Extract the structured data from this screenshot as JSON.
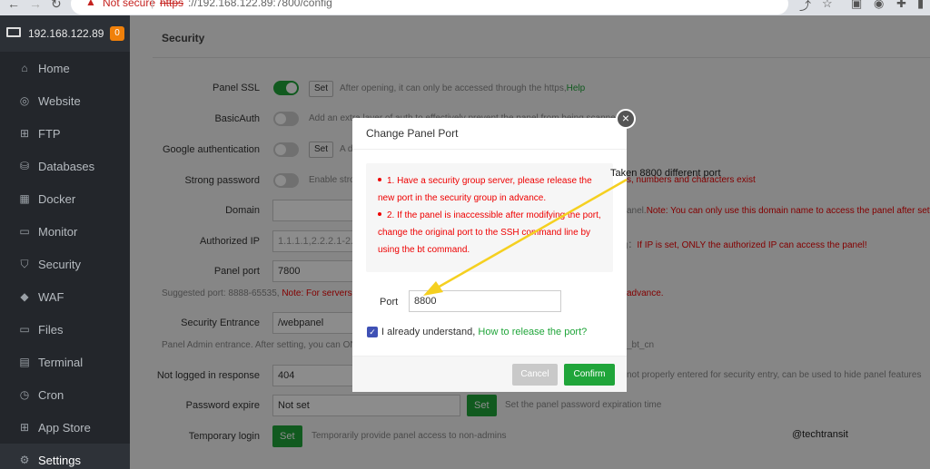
{
  "browser": {
    "not_secure": "Not secure",
    "url_scheme": "https",
    "url_rest": "://192.168.122.89:7800/config"
  },
  "sidebar": {
    "ip": "192.168.122.89",
    "badge": "0",
    "items": [
      {
        "label": "Home",
        "icon": "home-icon"
      },
      {
        "label": "Website",
        "icon": "globe-icon"
      },
      {
        "label": "FTP",
        "icon": "ftp-icon"
      },
      {
        "label": "Databases",
        "icon": "database-icon"
      },
      {
        "label": "Docker",
        "icon": "docker-icon"
      },
      {
        "label": "Monitor",
        "icon": "monitor-icon"
      },
      {
        "label": "Security",
        "icon": "shield-icon"
      },
      {
        "label": "WAF",
        "icon": "waf-icon"
      },
      {
        "label": "Files",
        "icon": "folder-icon"
      },
      {
        "label": "Terminal",
        "icon": "terminal-icon"
      },
      {
        "label": "Cron",
        "icon": "clock-icon"
      },
      {
        "label": "App Store",
        "icon": "grid-icon"
      },
      {
        "label": "Settings",
        "icon": "gear-icon"
      }
    ]
  },
  "settings": {
    "section_title": "Security",
    "panel_ssl": {
      "label": "Panel SSL",
      "set": "Set",
      "hint": "After opening, it can only be accessed through the https,",
      "hint_link": "Help"
    },
    "basicauth": {
      "label": "BasicAuth",
      "hint": "Add an extra layer of auth to effectively prevent the panel from being scanned H"
    },
    "google_auth": {
      "label": "Google authentication",
      "set": "Set",
      "hint": "A d"
    },
    "strong_password": {
      "label": "Strong password",
      "hint": "Enable stro",
      "hint_right": "s, numbers and characters exist"
    },
    "domain": {
      "label": "Domain",
      "hint": "anel.",
      "hint_red": "Note: You can only use this domain name to access the panel after setting"
    },
    "authorized_ip": {
      "label": "Authorized IP",
      "value": "1.1.1.1,2.2.2.1-2.2.2",
      "hint": "ing：",
      "hint_red": "If IP is set, ONLY the authorized IP can access the panel!"
    },
    "panel_port": {
      "label": "Panel port",
      "value": "7800"
    },
    "suggested": {
      "text": "Suggested port: 8888-65535,",
      "red": "Note: For servers w",
      "red_right": "advance."
    },
    "security_entrance": {
      "label": "Security Entrance",
      "value": "/webpanel"
    },
    "entrance_hint": {
      "text": "Panel Admin entrance. After setting, you can ONL",
      "right": "_bt_cn"
    },
    "not_logged": {
      "label": "Not logged in response",
      "value": "404",
      "hint": "not properly entered for security entry, can be used to hide panel features"
    },
    "password_expire": {
      "label": "Password expire",
      "value": "Not set",
      "set": "Set",
      "hint": "Set the panel password expiration time"
    },
    "temporary_login": {
      "label": "Temporary login",
      "set": "Set",
      "hint": "Temporarily provide panel access to non-admins"
    }
  },
  "dialog": {
    "title": "Change Panel Port",
    "notes": [
      "1. Have a security group server, please release the new port in the security group in advance.",
      "2. If the panel is inaccessible after modifying the port, change the original port to the SSH command line by using the bt command."
    ],
    "port_label": "Port",
    "port_value": "8800",
    "checkbox_text": "I already understand,",
    "checkbox_link": "How to release the port?",
    "cancel": "Cancel",
    "confirm": "Confirm"
  },
  "annotation": "Taken 8800 different port",
  "watermark": "@techtransit",
  "colors": {
    "accent": "#20a53a",
    "sidebar": "#23262b",
    "warning": "#ee0000",
    "annotation_arrow": "#f5d020"
  }
}
